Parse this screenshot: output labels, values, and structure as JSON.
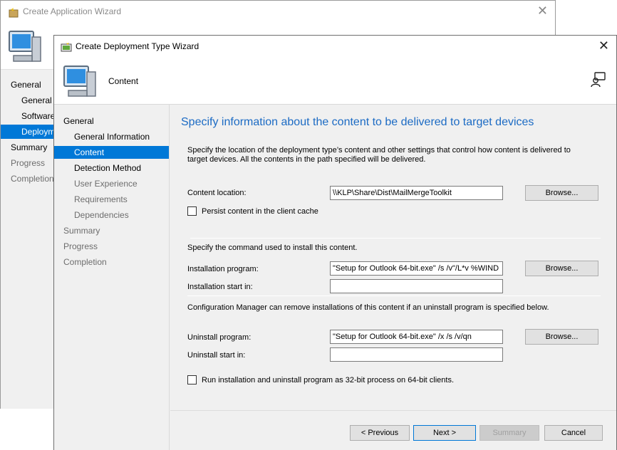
{
  "back_window": {
    "title": "Create Application Wizard",
    "close_glyph": "✕",
    "nav": [
      {
        "label": "General",
        "style": "dark"
      },
      {
        "label": "General I",
        "style": "dark"
      },
      {
        "label": "Software",
        "style": "dark"
      },
      {
        "label": "Deploym",
        "style": "sel"
      },
      {
        "label": "Summary",
        "style": "dark"
      },
      {
        "label": "Progress",
        "style": "grey"
      },
      {
        "label": "Completion",
        "style": "grey"
      }
    ]
  },
  "wizard": {
    "title": "Create Deployment Type Wizard",
    "close_glyph": "✕",
    "header_title": "Content",
    "nav": [
      {
        "label": "General",
        "style": "dark"
      },
      {
        "label": "General Information",
        "style": "dark"
      },
      {
        "label": "Content",
        "style": "sel"
      },
      {
        "label": "Detection Method",
        "style": "dark"
      },
      {
        "label": "User Experience",
        "style": "grey"
      },
      {
        "label": "Requirements",
        "style": "grey"
      },
      {
        "label": "Dependencies",
        "style": "grey"
      },
      {
        "label": "Summary",
        "style": "grey"
      },
      {
        "label": "Progress",
        "style": "grey"
      },
      {
        "label": "Completion",
        "style": "grey"
      }
    ]
  },
  "content_page": {
    "heading": "Specify information about the content to be delivered to target devices",
    "description": "Specify the location of the deployment type’s content and other settings that control how content is delivered to target devices. All the contents in the path specified will be delivered.",
    "content_location_label": "Content location:",
    "content_location_value": "\\\\KLP\\Share\\Dist\\MailMergeToolkit",
    "browse_label": "Browse...",
    "persist_label": "Persist content in the client cache",
    "persist_checked": false,
    "install_section_label": "Specify the command used to install this content.",
    "install_program_label": "Installation program:",
    "install_program_value": "\"Setup for Outlook 64-bit.exe\" /s /v\"/L*v %WIND",
    "install_start_label": "Installation start in:",
    "install_start_value": "",
    "uninstall_section_label": "Configuration Manager can remove installations of this content if an uninstall program is specified below.",
    "uninstall_program_label": "Uninstall program:",
    "uninstall_program_value": "\"Setup for Outlook 64-bit.exe\" /x /s /v/qn",
    "uninstall_start_label": "Uninstall start in:",
    "uninstall_start_value": "",
    "run32_label": "Run installation and uninstall program as 32-bit process on 64-bit clients.",
    "run32_checked": false
  },
  "footer": {
    "previous_label": "< Previous",
    "next_label": "Next >",
    "summary_label": "Summary",
    "cancel_label": "Cancel"
  },
  "icons": {
    "window_icon": "wizard-icon",
    "header_icon": "computer-icon",
    "help_icon": "help-person-icon"
  },
  "colors": {
    "accent": "#0078d7",
    "heading": "#1c6bc4",
    "panel": "#f0f0f0"
  }
}
